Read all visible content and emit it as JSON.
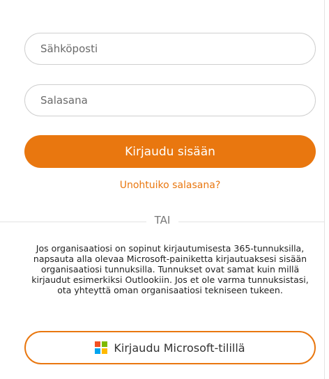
{
  "login": {
    "email_placeholder": "Sähköposti",
    "password_placeholder": "Salasana",
    "login_label": "Kirjaudu sisään",
    "forgot_label": "Unohtuiko salasana?",
    "divider_label": "TAI",
    "info_text": "Jos organisaatiosi on sopinut kirjautumisesta 365-tunnuksilla, napsauta alla olevaa Microsoft-painiketta kirjautuaksesi sisään organisaatiosi tunnuksilla. Tunnukset ovat samat kuin millä kirjaudut esimerkiksi Outlookiin. Jos et ole varma tunnuksistasi, ota yhteyttä oman organisaatiosi tekniseen tukeen.",
    "microsoft_label": "Kirjaudu Microsoft-tilillä"
  },
  "colors": {
    "accent": "#e9770f",
    "ms_red": "#f25022",
    "ms_green": "#7fba00",
    "ms_blue": "#00a4ef",
    "ms_yellow": "#ffb900"
  },
  "icons": {
    "microsoft": "microsoft-logo-icon"
  }
}
